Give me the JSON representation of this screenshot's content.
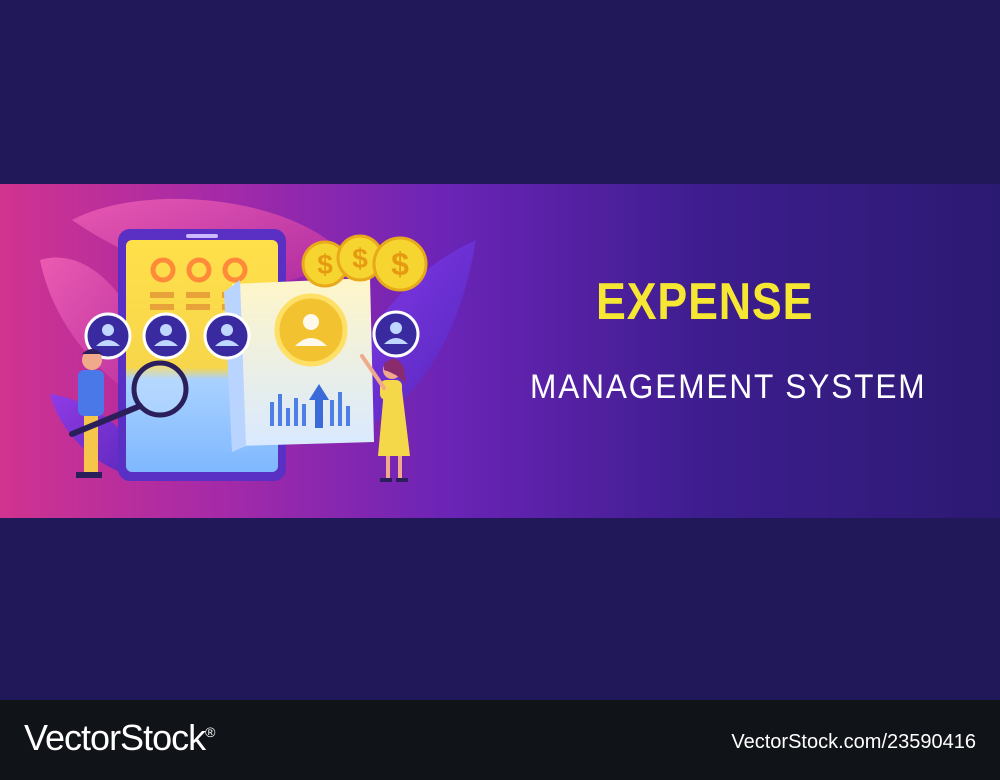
{
  "banner": {
    "headline": "EXPENSE",
    "subheadline": "MANAGEMENT SYSTEM"
  },
  "illustration": {
    "coin_symbol": "$",
    "icons": [
      "magnifier-icon",
      "user-icon",
      "dollar-coin-icon",
      "smartphone-icon",
      "report-document-icon",
      "bar-chart-icon",
      "arrow-up-icon"
    ]
  },
  "footer": {
    "brand": "VectorStock",
    "brand_mark": "®",
    "image_id": "VectorStock.com/23590416"
  },
  "colors": {
    "page_bg": "#21185a",
    "banner_left": "#d1338f",
    "banner_right": "#2b1a72",
    "headline": "#f6e832",
    "subheadline": "#ffffff",
    "footer_bg": "#101318",
    "coin": "#f6d531"
  }
}
